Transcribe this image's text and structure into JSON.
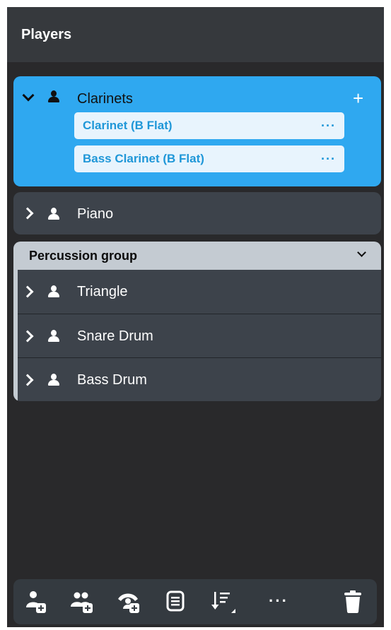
{
  "panel": {
    "title": "Players"
  },
  "players": [
    {
      "name": "Clarinets",
      "expanded": true,
      "selected": true,
      "add_label": "+",
      "instruments": [
        {
          "label": "Clarinet (B Flat)",
          "more": "···"
        },
        {
          "label": "Bass Clarinet (B Flat)",
          "more": "···"
        }
      ]
    },
    {
      "name": "Piano",
      "expanded": false,
      "selected": false
    }
  ],
  "group": {
    "title": "Percussion group",
    "players": [
      {
        "name": "Triangle"
      },
      {
        "name": "Snare Drum"
      },
      {
        "name": "Bass Drum"
      }
    ]
  },
  "toolbar": {
    "more_label": "···",
    "icons": [
      "add-solo-player-icon",
      "add-section-player-icon",
      "add-ensemble-icon",
      "player-list-icon",
      "sort-players-icon",
      "more-icon",
      "delete-icon"
    ]
  },
  "colors": {
    "panel_bg": "#29292b",
    "header_bg": "#36393d",
    "selected_card": "#2fa8f0",
    "card_bg": "#3d434b",
    "group_header": "#c4cbd2",
    "instrument_text": "#1f97d8"
  }
}
